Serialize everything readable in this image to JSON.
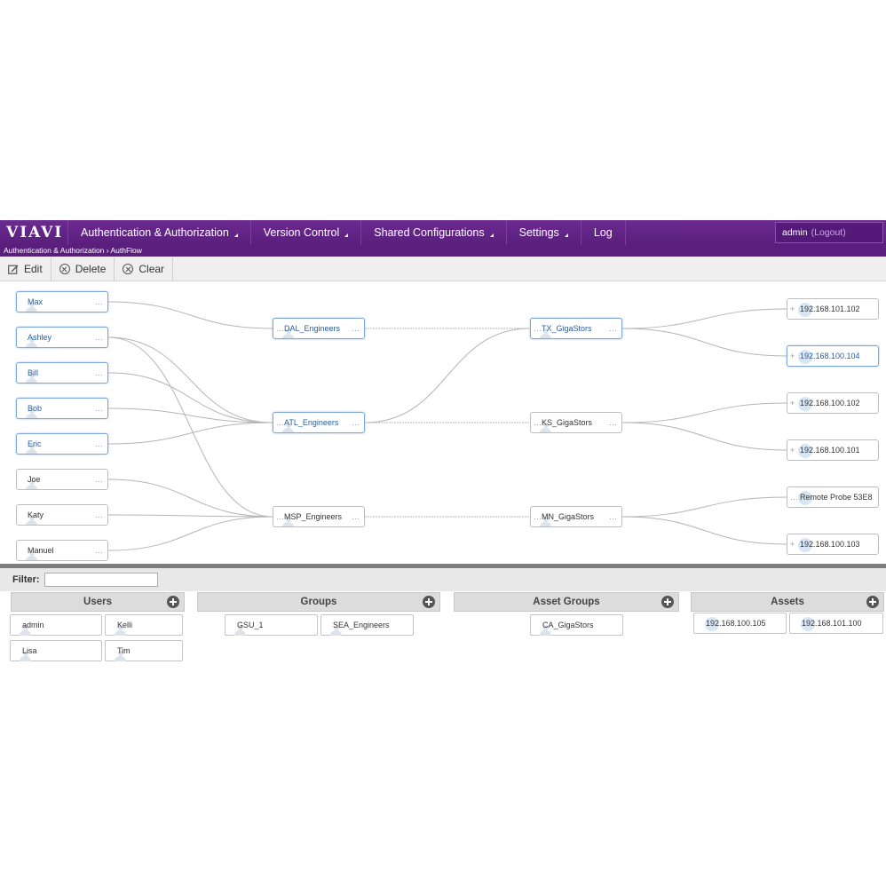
{
  "nav": {
    "logo": "VIAVI",
    "items": [
      {
        "label": "Authentication & Authorization",
        "has_caret": true
      },
      {
        "label": "Version Control",
        "has_caret": true
      },
      {
        "label": "Shared Configurations",
        "has_caret": true
      },
      {
        "label": "Settings",
        "has_caret": true
      },
      {
        "label": "Log",
        "has_caret": false
      }
    ],
    "user": "admin",
    "logout": "(Logout)"
  },
  "breadcrumb": "Authentication & Authorization › AuthFlow",
  "toolbar": {
    "edit": "Edit",
    "delete": "Delete",
    "clear": "Clear"
  },
  "flow": {
    "users": [
      {
        "label": "Max",
        "highlighted": true
      },
      {
        "label": "Ashley",
        "highlighted": true
      },
      {
        "label": "Bill",
        "highlighted": true
      },
      {
        "label": "Bob",
        "highlighted": true
      },
      {
        "label": "Eric",
        "highlighted": true
      },
      {
        "label": "Joe",
        "highlighted": false
      },
      {
        "label": "Katy",
        "highlighted": false
      },
      {
        "label": "Manuel",
        "highlighted": false
      }
    ],
    "groups": [
      {
        "label": "DAL_Engineers",
        "highlighted": true
      },
      {
        "label": "ATL_Engineers",
        "highlighted": true
      },
      {
        "label": "MSP_Engineers",
        "highlighted": false
      }
    ],
    "asset_groups": [
      {
        "label": "TX_GigaStors",
        "highlighted": true
      },
      {
        "label": "KS_GigaStors",
        "highlighted": false
      },
      {
        "label": "MN_GigaStors",
        "highlighted": false
      }
    ],
    "assets": [
      {
        "label": "192.168.101.102",
        "highlighted": false
      },
      {
        "label": "192.168.100.104",
        "highlighted": true
      },
      {
        "label": "192.168.100.102",
        "highlighted": false
      },
      {
        "label": "192.168.100.101",
        "highlighted": false
      },
      {
        "label": "Remote Probe 53E8",
        "highlighted": false
      },
      {
        "label": "192.168.100.103",
        "highlighted": false
      }
    ],
    "user_group_links": [
      [
        0,
        0
      ],
      [
        1,
        1
      ],
      [
        2,
        1
      ],
      [
        3,
        1
      ],
      [
        4,
        1
      ],
      [
        5,
        2
      ],
      [
        6,
        2
      ],
      [
        7,
        2
      ],
      [
        1,
        2
      ]
    ],
    "group_assetgroup_links": [
      [
        0,
        0
      ],
      [
        1,
        0
      ],
      [
        1,
        1
      ],
      [
        2,
        2
      ]
    ],
    "assetgroup_asset_links": [
      [
        0,
        0
      ],
      [
        0,
        1
      ],
      [
        1,
        2
      ],
      [
        1,
        3
      ],
      [
        2,
        4
      ],
      [
        2,
        5
      ]
    ]
  },
  "filter": {
    "label": "Filter:",
    "value": ""
  },
  "palette": {
    "users": {
      "title": "Users",
      "items": [
        "admin",
        "Kelli",
        "Lisa",
        "Tim"
      ]
    },
    "groups": {
      "title": "Groups",
      "items": [
        "GSU_1",
        "SEA_Engineers"
      ]
    },
    "asset_groups": {
      "title": "Asset Groups",
      "items": [
        "CA_GigaStors"
      ]
    },
    "assets": {
      "title": "Assets",
      "items": [
        "192.168.100.105",
        "192.168.101.100"
      ]
    }
  },
  "colors": {
    "nav_bg": "#5a1f7d",
    "highlight": "#7ea6d9",
    "highlight_text": "#2d5c9a"
  }
}
